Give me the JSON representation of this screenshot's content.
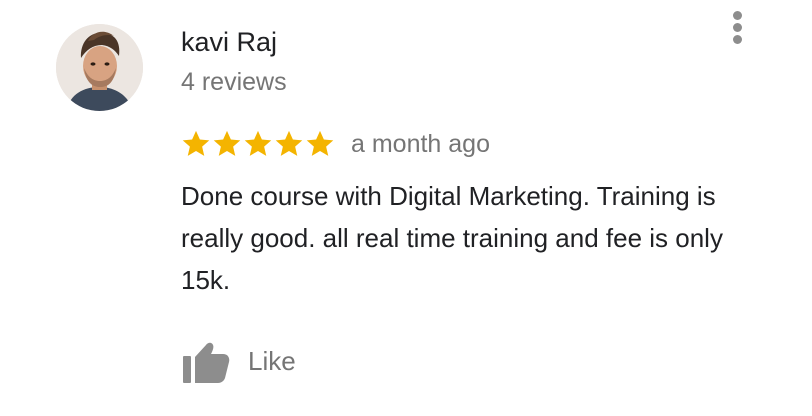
{
  "review": {
    "author_name": "kavi Raj",
    "review_count": "4 reviews",
    "rating": 5,
    "rating_max": 5,
    "date": "a month ago",
    "text": "Done course with Digital Marketing. Training is really good. all real time training and fee is only 15k.",
    "like_label": "Like"
  },
  "icons": {
    "avatar": "user-avatar-photo",
    "more": "more-vert-icon",
    "star": "star-icon",
    "like": "thumbs-up-icon"
  },
  "colors": {
    "star": "#f4b400",
    "primary_text": "#202124",
    "secondary_text": "#757575",
    "icon_gray": "#8d8d8d"
  }
}
